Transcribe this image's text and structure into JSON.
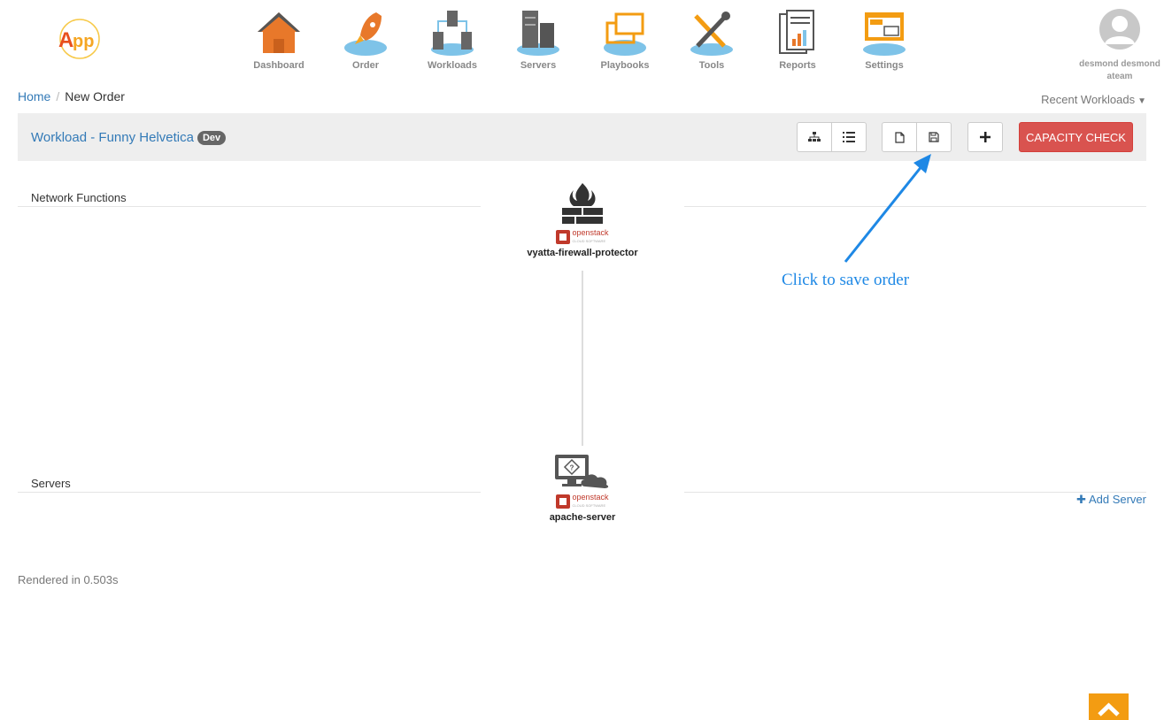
{
  "app": {
    "logo_text": "App"
  },
  "nav": [
    {
      "label": "Dashboard",
      "icon": "home-icon"
    },
    {
      "label": "Order",
      "icon": "rocket-icon"
    },
    {
      "label": "Workloads",
      "icon": "workloads-icon"
    },
    {
      "label": "Servers",
      "icon": "servers-icon"
    },
    {
      "label": "Playbooks",
      "icon": "playbooks-icon"
    },
    {
      "label": "Tools",
      "icon": "tools-icon"
    },
    {
      "label": "Reports",
      "icon": "reports-icon"
    },
    {
      "label": "Settings",
      "icon": "settings-icon"
    }
  ],
  "user": {
    "name": "desmond desmond",
    "team": "ateam"
  },
  "breadcrumb": {
    "home": "Home",
    "current": "New Order"
  },
  "recent": {
    "label": "Recent Workloads"
  },
  "workload": {
    "title": "Workload - Funny Helvetica",
    "badge": "Dev",
    "capacity_label": "CAPACITY CHECK"
  },
  "sections": {
    "network": "Network Functions",
    "servers": "Servers"
  },
  "nodes": {
    "firewall": {
      "label": "vyatta-firewall-protector",
      "provider": "openstack",
      "provider_sub": "CLOUD SOFTWARE"
    },
    "server": {
      "label": "apache-server",
      "provider": "openstack",
      "provider_sub": "CLOUD SOFTWARE"
    }
  },
  "annotation": "Click to save order",
  "add_server": "Add Server",
  "rendered": "Rendered in 0.503s",
  "colors": {
    "accent": "#337ab7",
    "danger": "#d9534f",
    "orange": "#f39c12",
    "annotation": "#1e88e5",
    "cloud": "#7ec3e8"
  }
}
